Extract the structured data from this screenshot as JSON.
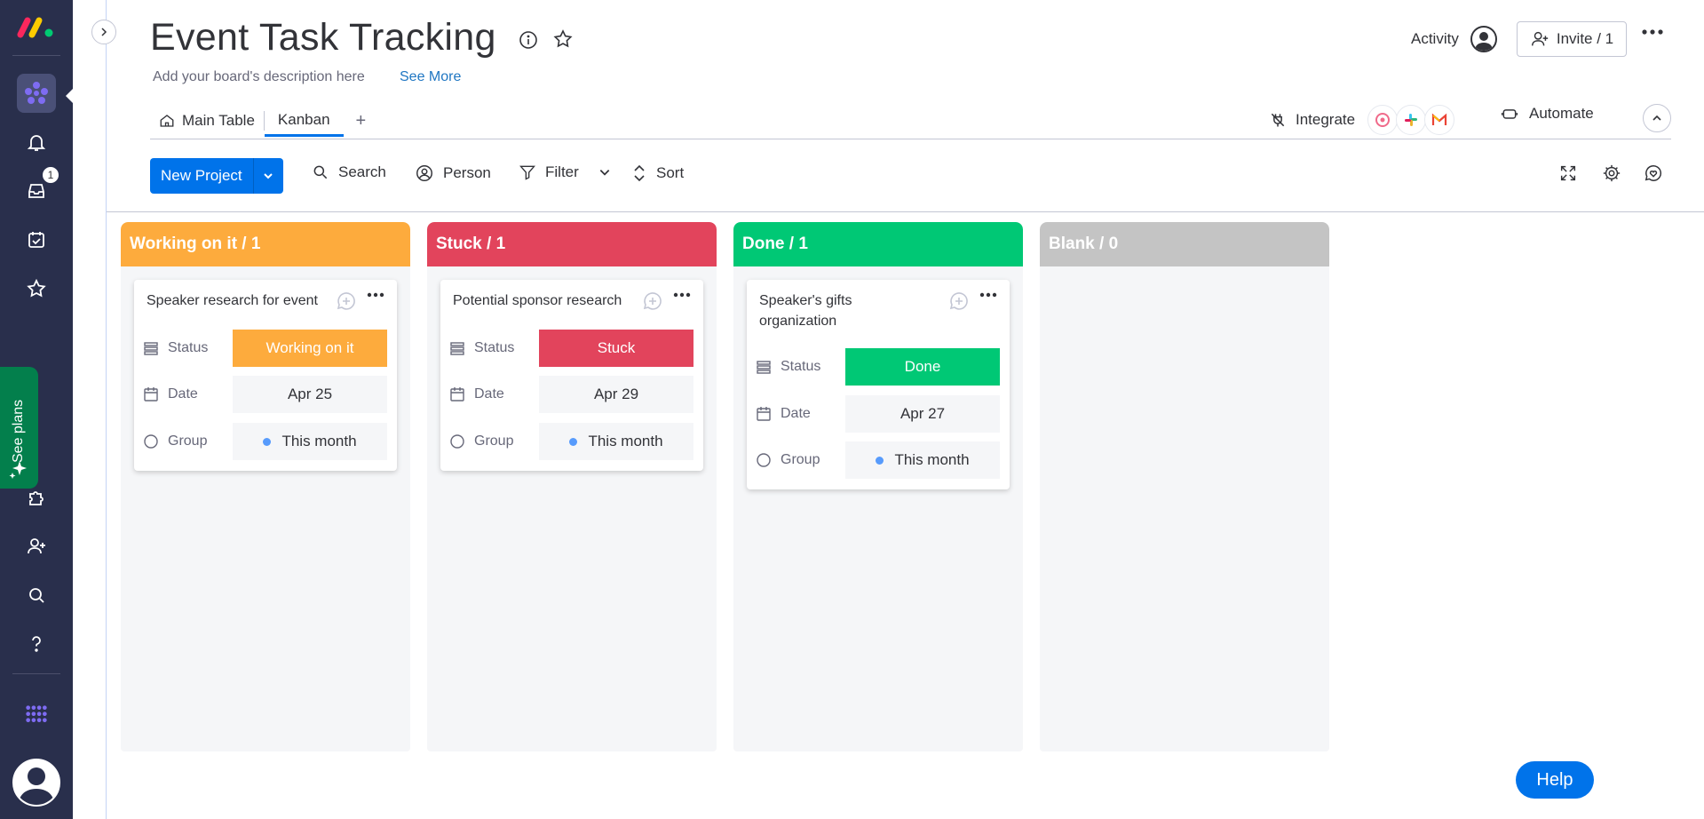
{
  "board": {
    "title": "Event Task Tracking",
    "description": "Add your board's description here",
    "see_more": "See More"
  },
  "header": {
    "activity": "Activity",
    "invite": "Invite / 1"
  },
  "tabs": [
    {
      "label": "Main Table",
      "active": false
    },
    {
      "label": "Kanban",
      "active": true
    }
  ],
  "tab_add": "+",
  "integrations": {
    "integrate_label": "Integrate",
    "automate_label": "Automate"
  },
  "toolbar": {
    "new_project": "New Project",
    "search": "Search",
    "person": "Person",
    "filter": "Filter",
    "sort": "Sort"
  },
  "sidebar": {
    "inbox_badge": "1",
    "see_plans": "See plans"
  },
  "columns": [
    {
      "header": "Working on it / 1",
      "color": "#fdab3d",
      "cards": [
        {
          "title": "Speaker research for event",
          "status": "Working on it",
          "status_color": "#fdab3d",
          "date": "Apr 25",
          "group": "This month"
        }
      ]
    },
    {
      "header": "Stuck / 1",
      "color": "#e2445c",
      "cards": [
        {
          "title": "Potential sponsor research",
          "status": "Stuck",
          "status_color": "#e2445c",
          "date": "Apr 29",
          "group": "This month"
        }
      ]
    },
    {
      "header": "Done / 1",
      "color": "#00c875",
      "cards": [
        {
          "title": "Speaker's gifts organization",
          "status": "Done",
          "status_color": "#00c875",
          "date": "Apr 27",
          "group": "This month"
        }
      ]
    },
    {
      "header": "Blank / 0",
      "color": "#c4c4c4",
      "cards": []
    }
  ],
  "card_labels": {
    "status": "Status",
    "date": "Date",
    "group": "Group"
  },
  "help": "Help"
}
